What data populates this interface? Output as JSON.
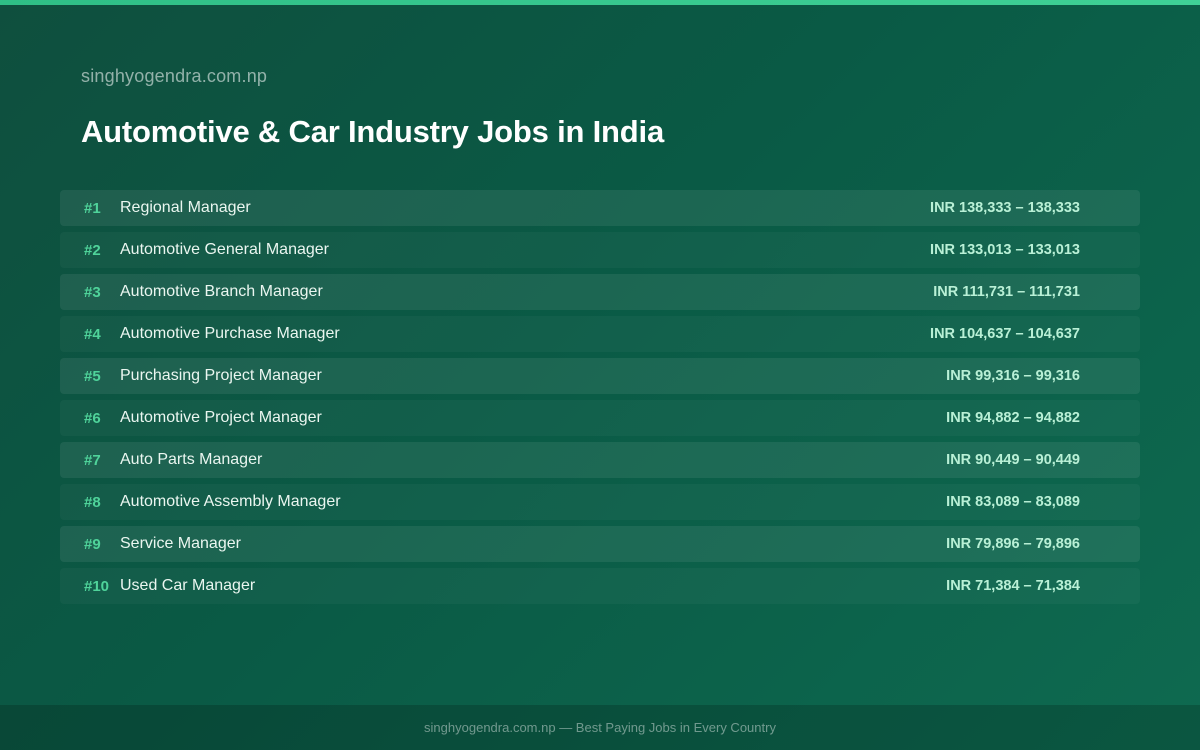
{
  "header": {
    "site": "singhyogendra.com.np",
    "title": "Automotive & Car Industry Jobs in India"
  },
  "jobs": [
    {
      "rank": "#1",
      "title": "Regional Manager",
      "salary": "INR 138,333 – 138,333"
    },
    {
      "rank": "#2",
      "title": "Automotive General Manager",
      "salary": "INR 133,013 – 133,013"
    },
    {
      "rank": "#3",
      "title": "Automotive Branch Manager",
      "salary": "INR 111,731 – 111,731"
    },
    {
      "rank": "#4",
      "title": "Automotive Purchase Manager",
      "salary": "INR 104,637 – 104,637"
    },
    {
      "rank": "#5",
      "title": "Purchasing Project Manager",
      "salary": "INR 99,316 – 99,316"
    },
    {
      "rank": "#6",
      "title": "Automotive Project Manager",
      "salary": "INR 94,882 – 94,882"
    },
    {
      "rank": "#7",
      "title": "Auto Parts Manager",
      "salary": "INR 90,449 – 90,449"
    },
    {
      "rank": "#8",
      "title": "Automotive Assembly Manager",
      "salary": "INR 83,089 – 83,089"
    },
    {
      "rank": "#9",
      "title": "Service Manager",
      "salary": "INR 79,896 – 79,896"
    },
    {
      "rank": "#10",
      "title": "Used Car Manager",
      "salary": "INR 71,384 – 71,384"
    }
  ],
  "footer": {
    "text": "singhyogendra.com.np — Best Paying Jobs in Every Country"
  },
  "colors": {
    "accent": "#3fd196",
    "rank": "#4fd39a",
    "salary": "#b9f0d6"
  }
}
